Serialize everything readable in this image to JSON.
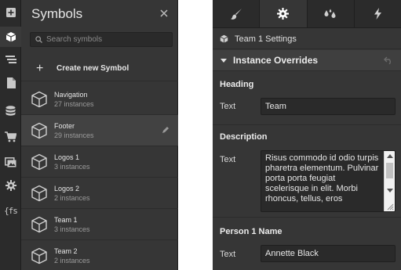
{
  "rail": {
    "items": [
      {
        "icon": "add-panel-icon"
      },
      {
        "icon": "symbols-cube-icon",
        "active": true
      },
      {
        "icon": "navigator-icon"
      },
      {
        "icon": "pages-icon"
      },
      {
        "icon": "cms-database-icon"
      },
      {
        "icon": "ecommerce-cart-icon"
      },
      {
        "icon": "assets-images-icon"
      },
      {
        "icon": "settings-gear-icon"
      },
      {
        "icon": "custom-code-icon",
        "glyph": "{fs"
      }
    ]
  },
  "symbols_panel": {
    "title": "Symbols",
    "search_placeholder": "Search symbols",
    "create_label": "Create new Symbol",
    "items": [
      {
        "name": "Navigation",
        "count": "27 instances"
      },
      {
        "name": "Footer",
        "count": "29 instances",
        "selected": true
      },
      {
        "name": "Logos 1",
        "count": "3 instances"
      },
      {
        "name": "Logos 2",
        "count": "2 instances"
      },
      {
        "name": "Team 1",
        "count": "3 instances"
      },
      {
        "name": "Team 2",
        "count": "2 instances"
      }
    ]
  },
  "settings_panel": {
    "tabs": [
      {
        "icon": "style-brush-icon"
      },
      {
        "icon": "settings-gear-icon",
        "active": true
      },
      {
        "icon": "interactions-drops-icon"
      },
      {
        "icon": "lightning-icon"
      }
    ],
    "breadcrumb": "Team 1 Settings",
    "section_title": "Instance Overrides",
    "groups": [
      {
        "title": "Heading",
        "field_label": "Text",
        "value": "Team"
      },
      {
        "title": "Description",
        "field_label": "Text",
        "value": "Risus commodo id odio turpis pharetra elementum. Pulvinar porta porta feugiat scelerisque in elit. Morbi rhoncus, tellus, eros"
      },
      {
        "title": "Person 1 Name",
        "field_label": "Text",
        "value": "Annette Black"
      }
    ]
  },
  "colors": {
    "panel_bg": "#363636",
    "rail_bg": "#2b2b2b",
    "input_bg": "#2a2a2a",
    "selected_row": "#424242",
    "text": "#e6e6e6",
    "muted_text": "#9a9a9a"
  }
}
